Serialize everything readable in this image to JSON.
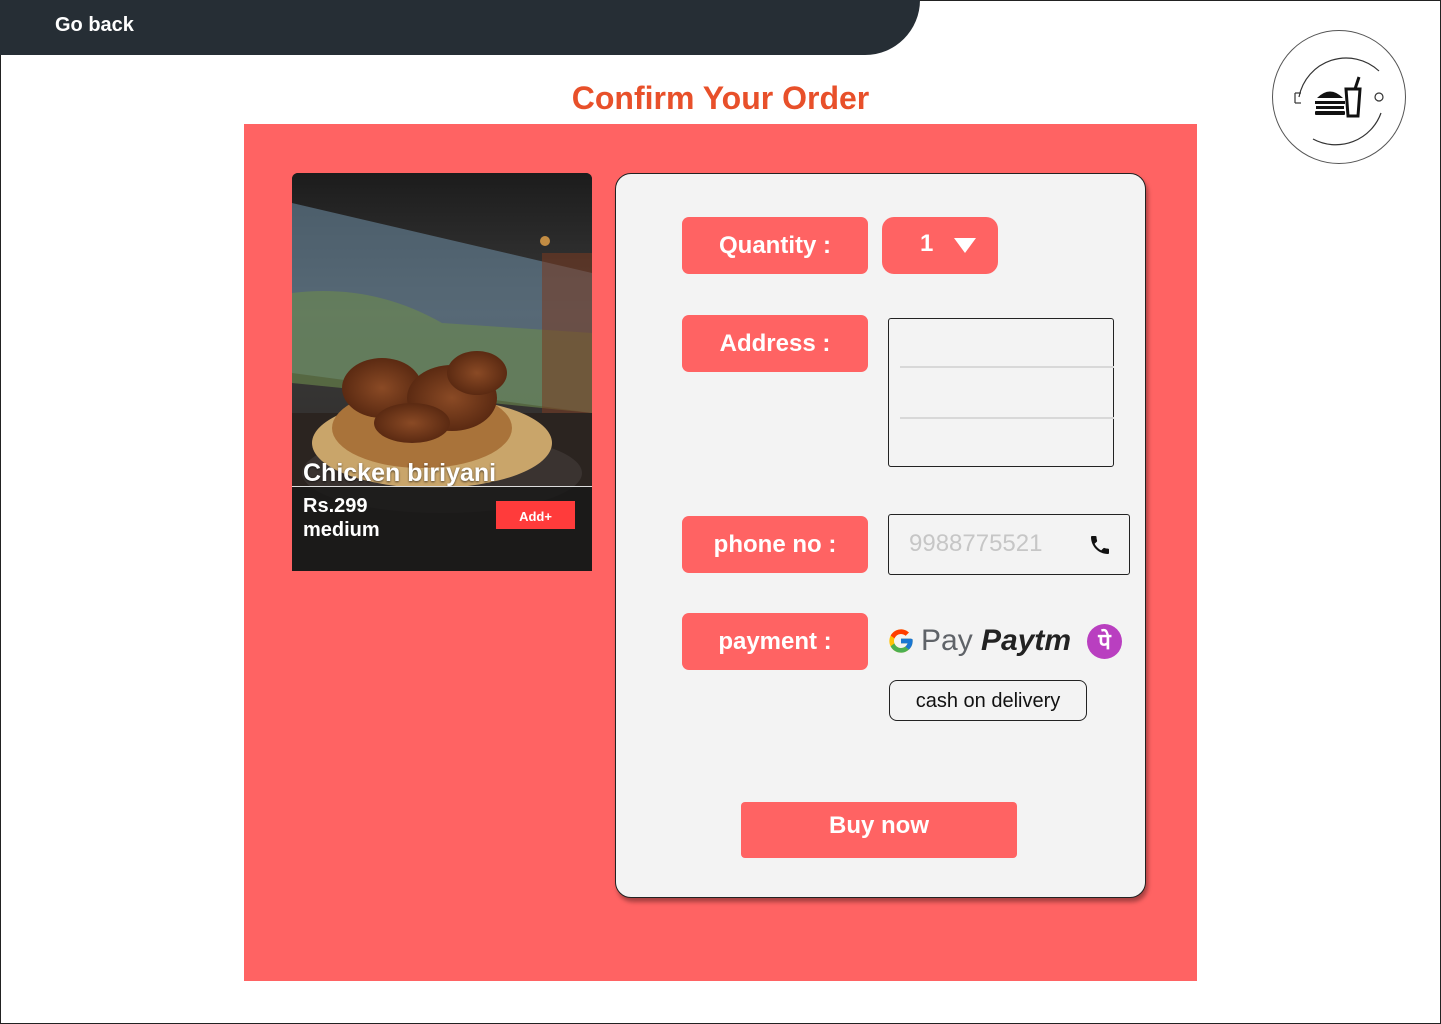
{
  "header": {
    "back_label": "Go back"
  },
  "page": {
    "title": "Confirm Your Order"
  },
  "product": {
    "name": "Chicken biriyani",
    "price": "Rs.299",
    "size": "medium",
    "add_label": "Add+"
  },
  "form": {
    "quantity_label": "Quantity :",
    "quantity_value": "1",
    "address_label": "Address :",
    "phone_label": "phone no :",
    "phone_placeholder": "9988775521",
    "payment_label": "payment :",
    "payment_methods": {
      "gpay": "Pay",
      "paytm": "Paytm",
      "phonepe": "पे"
    },
    "cod_label": "cash on delivery",
    "buy_label": "Buy now"
  },
  "colors": {
    "accent": "#ff6363",
    "title": "#e8502a",
    "topbar": "#262e35",
    "panel": "#f3f3f3"
  },
  "icons": {
    "logo": "burger-drink-logo-icon",
    "dropdown": "triangle-down-icon",
    "phone": "phone-icon",
    "gpay": "google-g-icon"
  }
}
